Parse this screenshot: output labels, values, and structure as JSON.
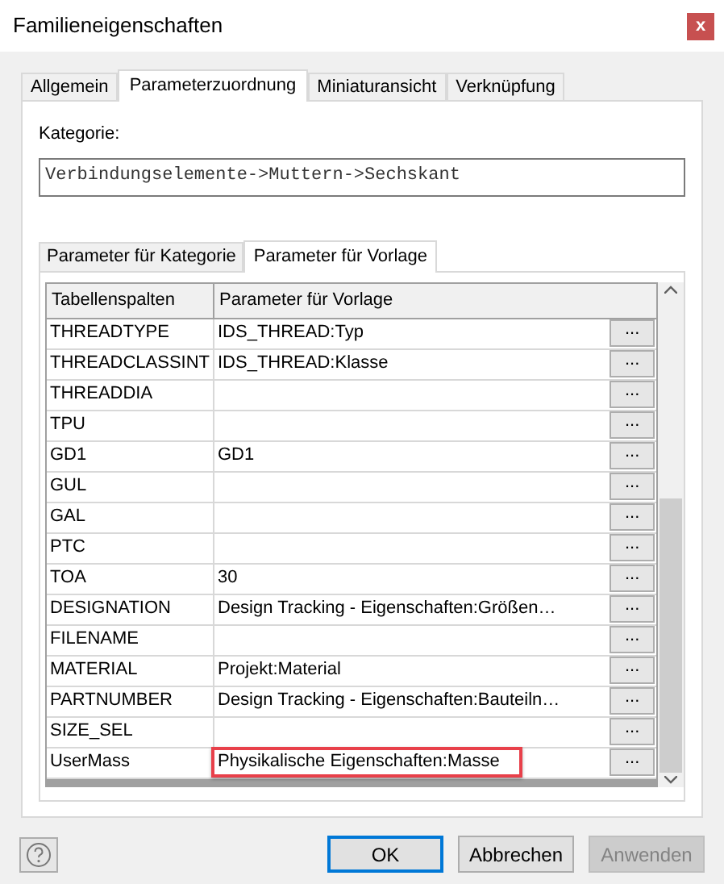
{
  "window": {
    "title": "Familieneigenschaften",
    "close": "x"
  },
  "tabs": [
    {
      "label": "Allgemein",
      "selected": false
    },
    {
      "label": "Parameterzuordnung",
      "selected": true
    },
    {
      "label": "Miniaturansicht",
      "selected": false
    },
    {
      "label": "Verknüpfung",
      "selected": false
    }
  ],
  "category": {
    "label": "Kategorie:",
    "value": "Verbindungselemente->Muttern->Sechskant"
  },
  "subtabs": [
    {
      "label": "Parameter für Kategorie",
      "selected": false
    },
    {
      "label": "Parameter für Vorlage",
      "selected": true
    }
  ],
  "table": {
    "columns": [
      "Tabellenspalten",
      "Parameter für Vorlage"
    ],
    "rows": [
      {
        "column": "THREADTYPE",
        "parameter": "IDS_THREAD:Typ",
        "button": "...",
        "highlighted": false
      },
      {
        "column": "THREADCLASSINT",
        "parameter": "IDS_THREAD:Klasse",
        "button": "...",
        "highlighted": false
      },
      {
        "column": "THREADDIA",
        "parameter": "",
        "button": "...",
        "highlighted": false
      },
      {
        "column": "TPU",
        "parameter": "",
        "button": "...",
        "highlighted": false
      },
      {
        "column": "GD1",
        "parameter": "GD1",
        "button": "...",
        "highlighted": false
      },
      {
        "column": "GUL",
        "parameter": "",
        "button": "...",
        "highlighted": false
      },
      {
        "column": "GAL",
        "parameter": "",
        "button": "...",
        "highlighted": false
      },
      {
        "column": "PTC",
        "parameter": "",
        "button": "...",
        "highlighted": false
      },
      {
        "column": "TOA",
        "parameter": "30",
        "button": "...",
        "highlighted": false
      },
      {
        "column": "DESIGNATION",
        "parameter": "Design Tracking - Eigenschaften:Größen…",
        "button": "...",
        "highlighted": false
      },
      {
        "column": "FILENAME",
        "parameter": "",
        "button": "...",
        "highlighted": false
      },
      {
        "column": "MATERIAL",
        "parameter": "Projekt:Material",
        "button": "...",
        "highlighted": false
      },
      {
        "column": "PARTNUMBER",
        "parameter": "Design Tracking - Eigenschaften:Bauteiln…",
        "button": "...",
        "highlighted": false
      },
      {
        "column": "SIZE_SEL",
        "parameter": "",
        "button": "...",
        "highlighted": false
      },
      {
        "column": "UserMass",
        "parameter": "Physikalische Eigenschaften:Masse",
        "button": "...",
        "highlighted": true
      }
    ]
  },
  "buttons": [
    {
      "label": "OK",
      "default": true,
      "disabled": false
    },
    {
      "label": "Abbrechen",
      "default": false,
      "disabled": false
    },
    {
      "label": "Anwenden",
      "default": false,
      "disabled": true
    }
  ]
}
